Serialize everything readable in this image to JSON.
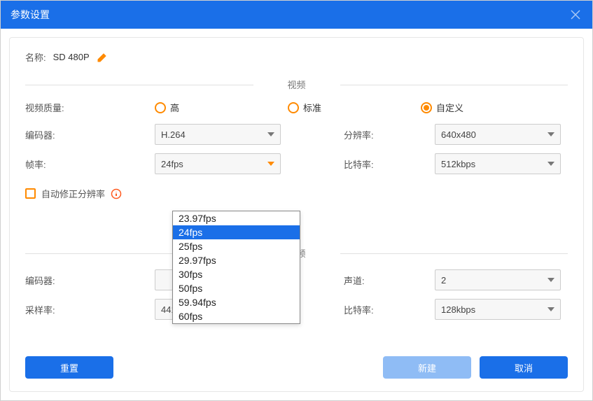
{
  "title": "参数设置",
  "name": {
    "label": "名称:",
    "value": "SD 480P"
  },
  "sections": {
    "video": "视频",
    "audio": "音频"
  },
  "video": {
    "quality": {
      "label": "视频质量:",
      "options": [
        "高",
        "标准",
        "自定义"
      ],
      "selected": "自定义"
    },
    "encoder": {
      "label": "编码器:",
      "value": "H.264"
    },
    "resolution": {
      "label": "分辨率:",
      "value": "640x480"
    },
    "framerate": {
      "label": "帧率:",
      "value": "24fps",
      "options": [
        "23.97fps",
        "24fps",
        "25fps",
        "29.97fps",
        "30fps",
        "50fps",
        "59.94fps",
        "60fps"
      ]
    },
    "bitrate": {
      "label": "比特率:",
      "value": "512kbps"
    },
    "autofix": {
      "label": "自动修正分辨率"
    }
  },
  "audio": {
    "encoder": {
      "label": "编码器:",
      "value": ""
    },
    "channels": {
      "label": "声道:",
      "value": "2"
    },
    "samplerate": {
      "label": "采样率:",
      "value": "44100Hz"
    },
    "bitrate": {
      "label": "比特率:",
      "value": "128kbps"
    }
  },
  "buttons": {
    "reset": "重置",
    "new": "新建",
    "cancel": "取消"
  }
}
